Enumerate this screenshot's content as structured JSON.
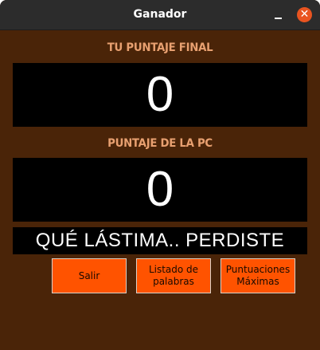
{
  "window": {
    "title": "Ganador",
    "close_glyph": "✕"
  },
  "player_score": {
    "label": "TU PUNTAJE FINAL",
    "value": "0"
  },
  "pc_score": {
    "label": "PUNTAJE DE LA PC",
    "value": "0"
  },
  "result_message": "QUÉ LÁSTIMA.. PERDISTE",
  "buttons": {
    "exit": "Salir",
    "word_list_line1": "Listado de",
    "word_list_line2": "palabras",
    "high_scores_line1": "Puntuaciones",
    "high_scores_line2": "Máximas"
  },
  "colors": {
    "background": "#4a2408",
    "label": "#e8a070",
    "button": "#ff5300",
    "close": "#e95420"
  }
}
